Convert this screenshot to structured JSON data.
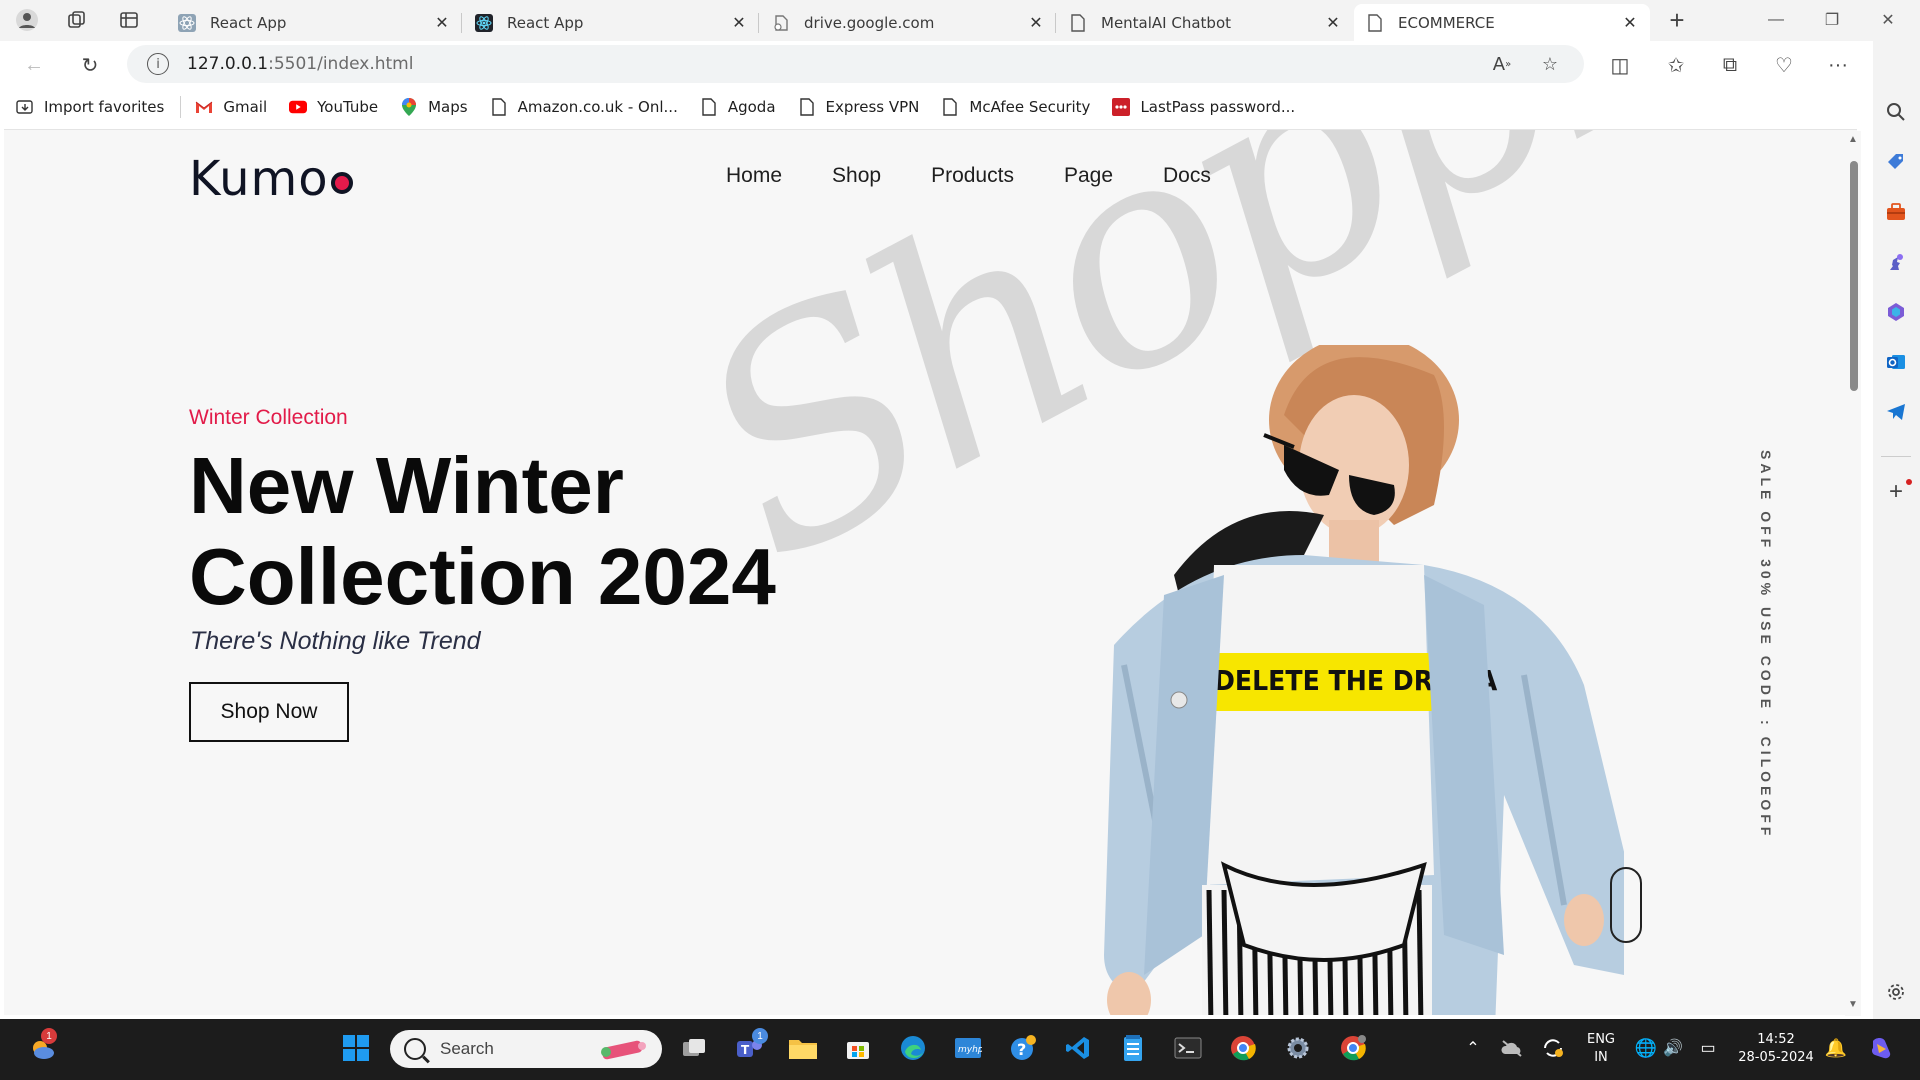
{
  "browser": {
    "tabs": [
      {
        "title": "React App",
        "active": false
      },
      {
        "title": "React App",
        "active": false
      },
      {
        "title": "drive.google.com",
        "active": false
      },
      {
        "title": "MentalAI Chatbot",
        "active": false
      },
      {
        "title": "ECOMMERCE",
        "active": true
      }
    ],
    "url_host": "127.0.0.1",
    "url_path": ":5501/index.html",
    "favorites": [
      {
        "label": "Import favorites",
        "icon": "import-icon"
      },
      {
        "label": "Gmail",
        "icon": "gmail-icon"
      },
      {
        "label": "YouTube",
        "icon": "youtube-icon"
      },
      {
        "label": "Maps",
        "icon": "maps-icon"
      },
      {
        "label": "Amazon.co.uk - Onl...",
        "icon": "page-icon"
      },
      {
        "label": "Agoda",
        "icon": "page-icon"
      },
      {
        "label": "Express VPN",
        "icon": "page-icon"
      },
      {
        "label": "McAfee Security",
        "icon": "page-icon"
      },
      {
        "label": "LastPass password...",
        "icon": "lastpass-icon"
      }
    ]
  },
  "site": {
    "logo": "Kumo",
    "nav": [
      "Home",
      "Shop",
      "Products",
      "Page",
      "Docs"
    ],
    "hero": {
      "eyebrow": "Winter Collection",
      "headline": "New Winter Collection 2024",
      "tagline": "There's Nothing like Trend",
      "button": "Shop Now",
      "watermark": "Shoppis",
      "shirt_text": "DELETE THE DRAMA",
      "side_text": "SALE OFF 30% USE CODE : CILOEOFF"
    },
    "colors": {
      "accent": "#e21b49",
      "text": "#0a0a0a",
      "background": "#f7f7f7"
    }
  },
  "taskbar": {
    "search_placeholder": "Search",
    "language": "ENG",
    "region": "IN",
    "time": "14:52",
    "date": "28-05-2024",
    "weather_badge": "1",
    "teams_badge": "1"
  }
}
